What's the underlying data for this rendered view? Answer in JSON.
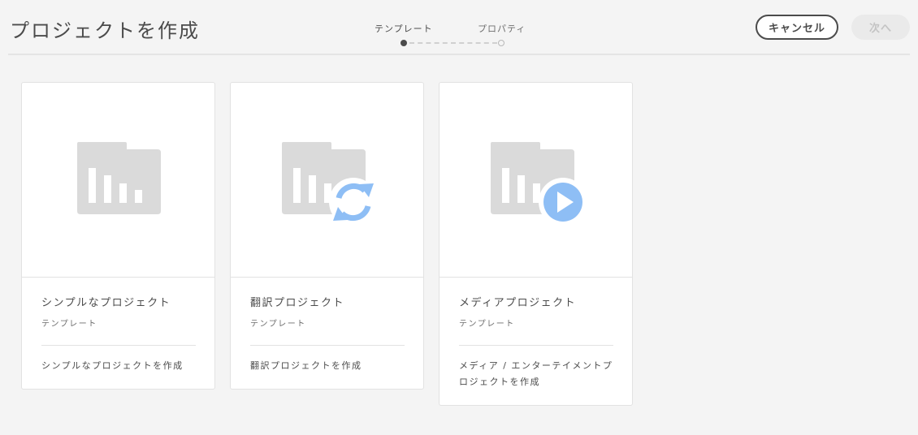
{
  "header": {
    "title": "プロジェクトを作成",
    "cancel_label": "キャンセル",
    "next_label": "次へ"
  },
  "wizard": {
    "steps": [
      {
        "label": "テンプレート",
        "state": "active"
      },
      {
        "label": "プロパティ",
        "state": "inactive"
      }
    ]
  },
  "cards": [
    {
      "title": "シンプルなプロジェクト",
      "subtitle": "テンプレート",
      "description": "シンプルなプロジェクトを作成",
      "icon": "folder-chart-icon"
    },
    {
      "title": "翻訳プロジェクト",
      "subtitle": "テンプレート",
      "description": "翻訳プロジェクトを作成",
      "icon": "folder-chart-sync-icon"
    },
    {
      "title": "メディアプロジェクト",
      "subtitle": "テンプレート",
      "description": "メディア / エンターテイメントプロジェクトを作成",
      "icon": "folder-chart-play-icon"
    }
  ],
  "colors": {
    "background": "#f4f4f4",
    "card": "#ffffff",
    "folder": "#dadada",
    "accent": "#8ebef5",
    "text": "#4b4b4b"
  }
}
